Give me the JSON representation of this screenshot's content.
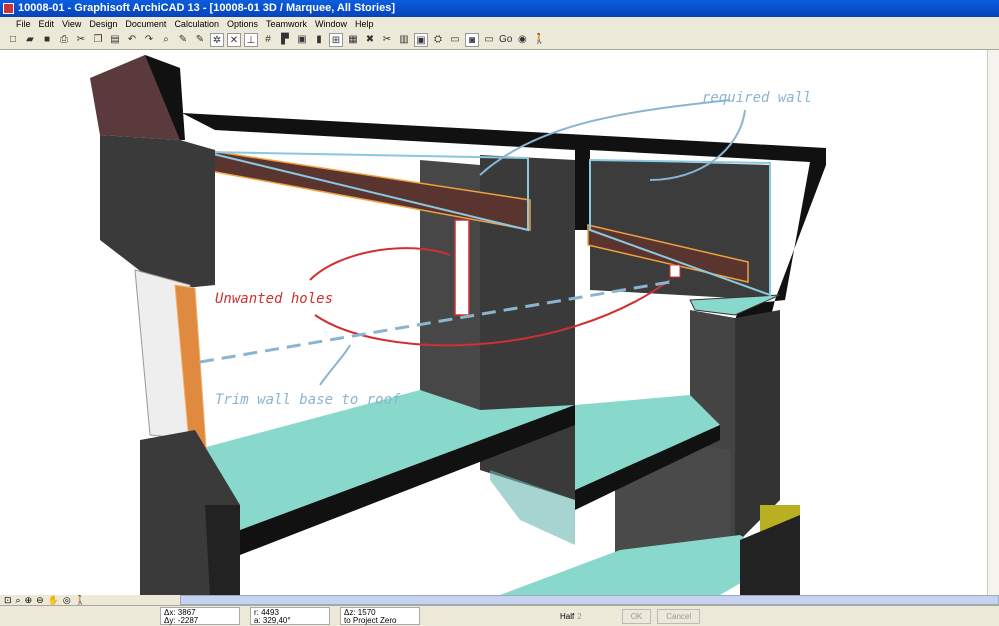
{
  "window": {
    "title": "10008-01 - Graphisoft ArchiCAD 13 - [10008-01 3D / Marquee, All Stories]"
  },
  "menu": [
    "File",
    "Edit",
    "View",
    "Design",
    "Document",
    "Calculation",
    "Options",
    "Teamwork",
    "Window",
    "Help"
  ],
  "toolbar": {
    "go_label": "Go"
  },
  "annotations": {
    "required": "required wall",
    "holes": "Unwanted holes",
    "trim": "Trim wall base to roof",
    "colors": {
      "blue": "#8ab4d0",
      "red": "#d03030"
    }
  },
  "status": {
    "dx": "Δx: 3867",
    "dy": "Δy: -2287",
    "r": "r: 4493",
    "a": "a: 329,40°",
    "dz": "Δz: 1570",
    "ref": "to Project Zero",
    "pen": "Half",
    "pen_num": "2",
    "ok": "OK",
    "cancel": "Cancel"
  }
}
